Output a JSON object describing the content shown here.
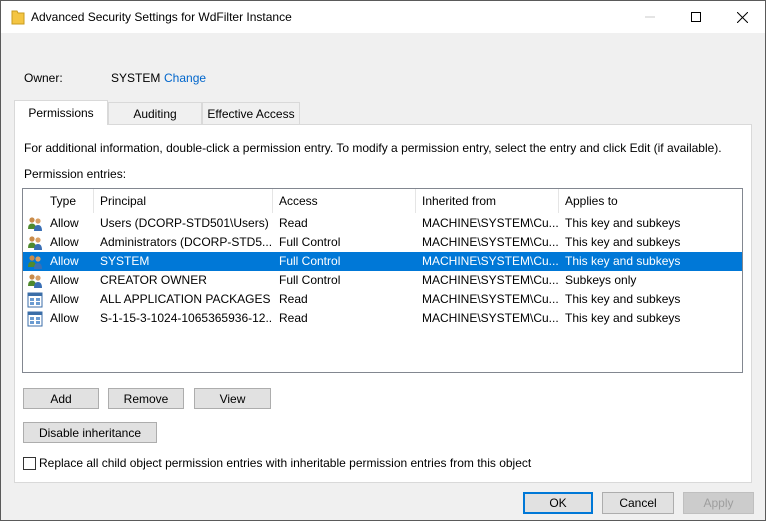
{
  "window": {
    "title": "Advanced Security Settings for WdFilter Instance"
  },
  "owner": {
    "label": "Owner:",
    "value": "SYSTEM",
    "change_link": "Change"
  },
  "tabs": [
    {
      "label": "Permissions",
      "active": true
    },
    {
      "label": "Auditing",
      "active": false
    },
    {
      "label": "Effective Access",
      "active": false
    }
  ],
  "info_text": "For additional information, double-click a permission entry. To modify a permission entry, select the entry and click Edit (if available).",
  "entries_label": "Permission entries:",
  "columns": [
    "Type",
    "Principal",
    "Access",
    "Inherited from",
    "Applies to"
  ],
  "entries": [
    {
      "icon": "users-group-icon",
      "type": "Allow",
      "principal": "Users (DCORP-STD501\\Users)",
      "access": "Read",
      "inherited_from": "MACHINE\\SYSTEM\\Cu...",
      "applies_to": "This key and subkeys",
      "selected": false
    },
    {
      "icon": "users-group-icon",
      "type": "Allow",
      "principal": "Administrators (DCORP-STD5...",
      "access": "Full Control",
      "inherited_from": "MACHINE\\SYSTEM\\Cu...",
      "applies_to": "This key and subkeys",
      "selected": false
    },
    {
      "icon": "users-group-icon",
      "type": "Allow",
      "principal": "SYSTEM",
      "access": "Full Control",
      "inherited_from": "MACHINE\\SYSTEM\\Cu...",
      "applies_to": "This key and subkeys",
      "selected": true
    },
    {
      "icon": "users-group-icon",
      "type": "Allow",
      "principal": "CREATOR OWNER",
      "access": "Full Control",
      "inherited_from": "MACHINE\\SYSTEM\\Cu...",
      "applies_to": "Subkeys only",
      "selected": false
    },
    {
      "icon": "app-package-icon",
      "type": "Allow",
      "principal": "ALL APPLICATION PACKAGES",
      "access": "Read",
      "inherited_from": "MACHINE\\SYSTEM\\Cu...",
      "applies_to": "This key and subkeys",
      "selected": false
    },
    {
      "icon": "app-package-icon",
      "type": "Allow",
      "principal": "S-1-15-3-1024-1065365936-12...",
      "access": "Read",
      "inherited_from": "MACHINE\\SYSTEM\\Cu...",
      "applies_to": "This key and subkeys",
      "selected": false
    }
  ],
  "buttons": {
    "add": "Add",
    "remove": "Remove",
    "view": "View",
    "disable_inheritance": "Disable inheritance",
    "ok": "OK",
    "cancel": "Cancel",
    "apply": "Apply"
  },
  "replace_checkbox": {
    "label": "Replace all child object permission entries with inheritable permission entries from this object",
    "checked": false
  },
  "colors": {
    "selection": "#0078d7",
    "link": "#0066cc",
    "default_button_border": "#0078d7"
  }
}
